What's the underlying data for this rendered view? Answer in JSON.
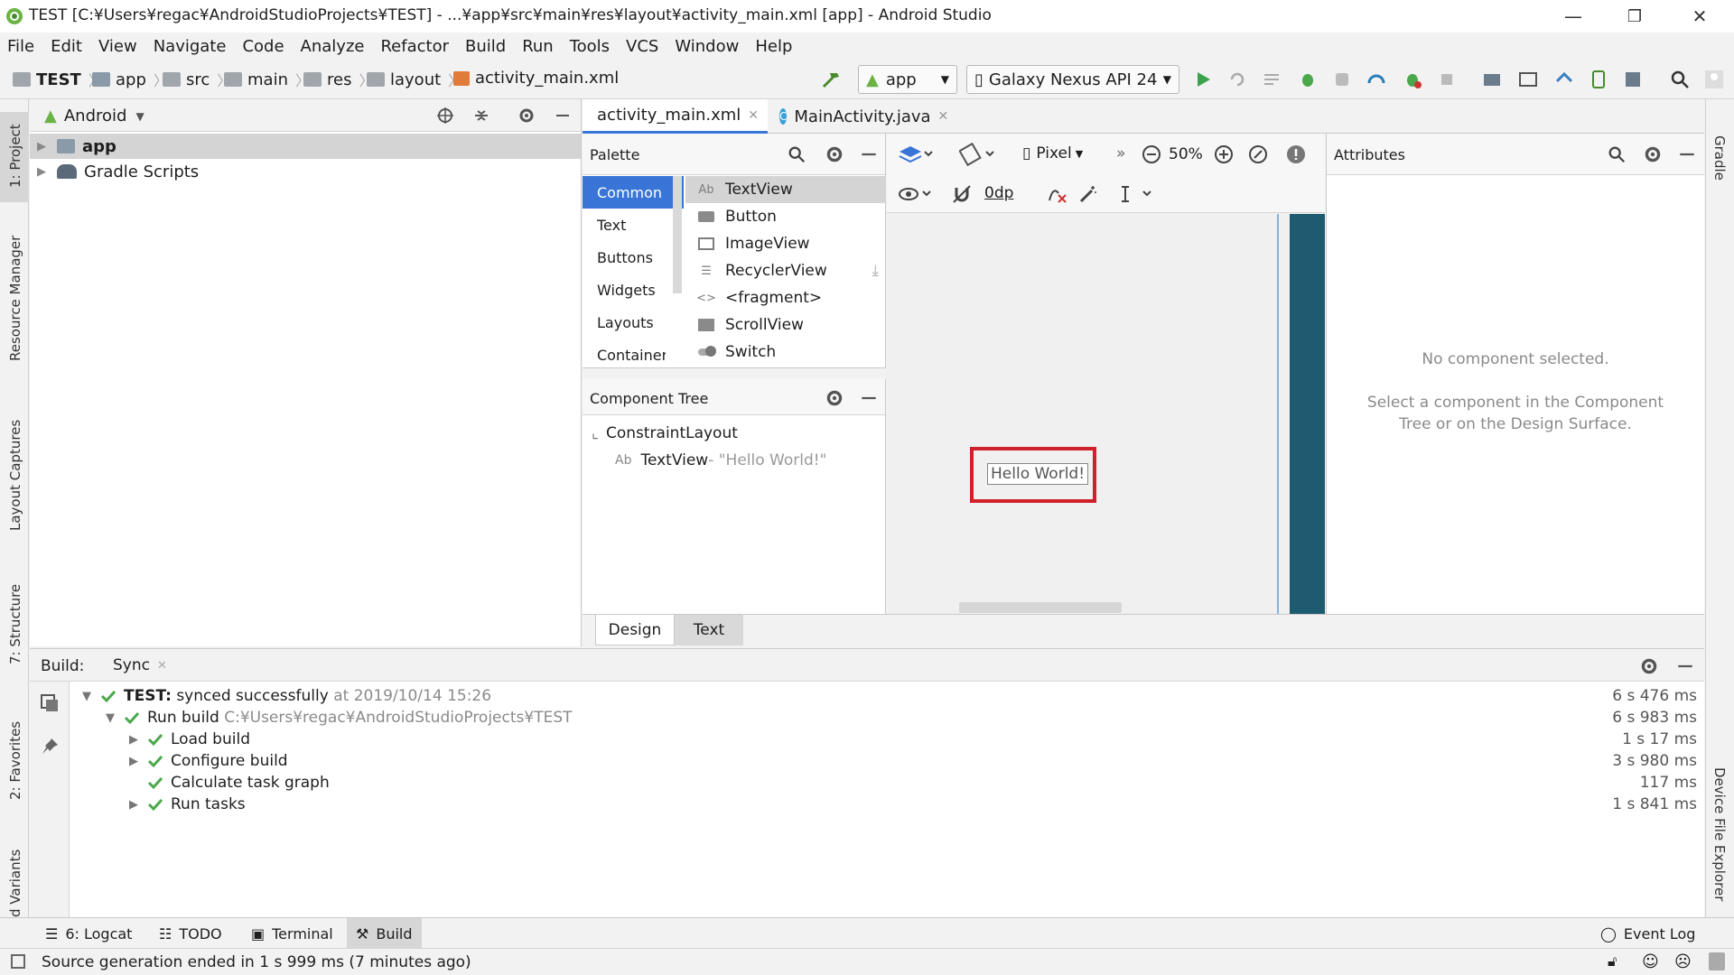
{
  "window": {
    "title": "TEST [C:¥Users¥regac¥AndroidStudioProjects¥TEST] - ...¥app¥src¥main¥res¥layout¥activity_main.xml [app] - Android Studio",
    "minimize": "—",
    "restore": "❐",
    "close": "✕"
  },
  "menu": [
    "File",
    "Edit",
    "View",
    "Navigate",
    "Code",
    "Analyze",
    "Refactor",
    "Build",
    "Run",
    "Tools",
    "VCS",
    "Window",
    "Help"
  ],
  "breadcrumb": [
    "TEST",
    "app",
    "src",
    "main",
    "res",
    "layout",
    "activity_main.xml"
  ],
  "toolbar": {
    "run_config": "app",
    "device": "Galaxy Nexus API 24"
  },
  "project_panel": {
    "view_mode": "Android",
    "items": [
      "app",
      "Gradle Scripts"
    ]
  },
  "editor_tabs": [
    {
      "label": "activity_main.xml",
      "active": true
    },
    {
      "label": "MainActivity.java",
      "active": false
    }
  ],
  "palette": {
    "title": "Palette",
    "categories": [
      "Common",
      "Text",
      "Buttons",
      "Widgets",
      "Layouts",
      "Containers"
    ],
    "selected_category": "Common",
    "items": [
      {
        "icon": "Ab",
        "label": "TextView"
      },
      {
        "icon": "",
        "label": "Button"
      },
      {
        "icon": "",
        "label": "ImageView"
      },
      {
        "icon": "",
        "label": "RecyclerView"
      },
      {
        "icon": "<>",
        "label": "<fragment>"
      },
      {
        "icon": "",
        "label": "ScrollView"
      },
      {
        "icon": "",
        "label": "Switch"
      }
    ]
  },
  "component_tree": {
    "title": "Component Tree",
    "root": "ConstraintLayout",
    "child_prefix": "Ab",
    "child": "TextView",
    "child_text": "- \"Hello World!\""
  },
  "design_toolbar": {
    "device": "Pixel",
    "zoom": "50%",
    "margin": "0dp"
  },
  "canvas": {
    "hello_text": "Hello World!",
    "highlight_color": "#d0202a",
    "blueprint_color": "#1f5b70"
  },
  "attributes": {
    "title": "Attributes",
    "empty_title": "No component selected.",
    "empty_line1": "Select a component in the Component",
    "empty_line2": "Tree or on the Design Surface."
  },
  "design_tabs": [
    "Design",
    "Text"
  ],
  "build": {
    "label": "Build:",
    "tab": "Sync",
    "rows": [
      {
        "indent": 0,
        "expander": "▼",
        "bold": "TEST:",
        "text": " synced successfully",
        "muted": " at 2019/10/14 15:26",
        "time": "6 s 476 ms"
      },
      {
        "indent": 1,
        "expander": "▼",
        "bold": "",
        "text": "Run build",
        "muted": " C:¥Users¥regac¥AndroidStudioProjects¥TEST",
        "time": "6 s 983 ms"
      },
      {
        "indent": 2,
        "expander": "▶",
        "bold": "",
        "text": "Load build",
        "muted": "",
        "time": "1 s 17 ms"
      },
      {
        "indent": 2,
        "expander": "▶",
        "bold": "",
        "text": "Configure build",
        "muted": "",
        "time": "3 s 980 ms"
      },
      {
        "indent": 2,
        "expander": "",
        "bold": "",
        "text": "Calculate task graph",
        "muted": "",
        "time": "117 ms"
      },
      {
        "indent": 2,
        "expander": "▶",
        "bold": "",
        "text": "Run tasks",
        "muted": "",
        "time": "1 s 841 ms"
      }
    ]
  },
  "left_strip": [
    "1: Project",
    "Resource Manager",
    "Layout Captures",
    "7: Structure",
    "2: Favorites",
    "d Variants"
  ],
  "right_strip": [
    "Gradle",
    "Device File Explorer"
  ],
  "bottom_tabs": [
    "6: Logcat",
    "TODO",
    "Terminal",
    "Build"
  ],
  "event_log": "Event Log",
  "status": "Source generation ended in 1 s 999 ms (7 minutes ago)",
  "accent": "#3875d7"
}
